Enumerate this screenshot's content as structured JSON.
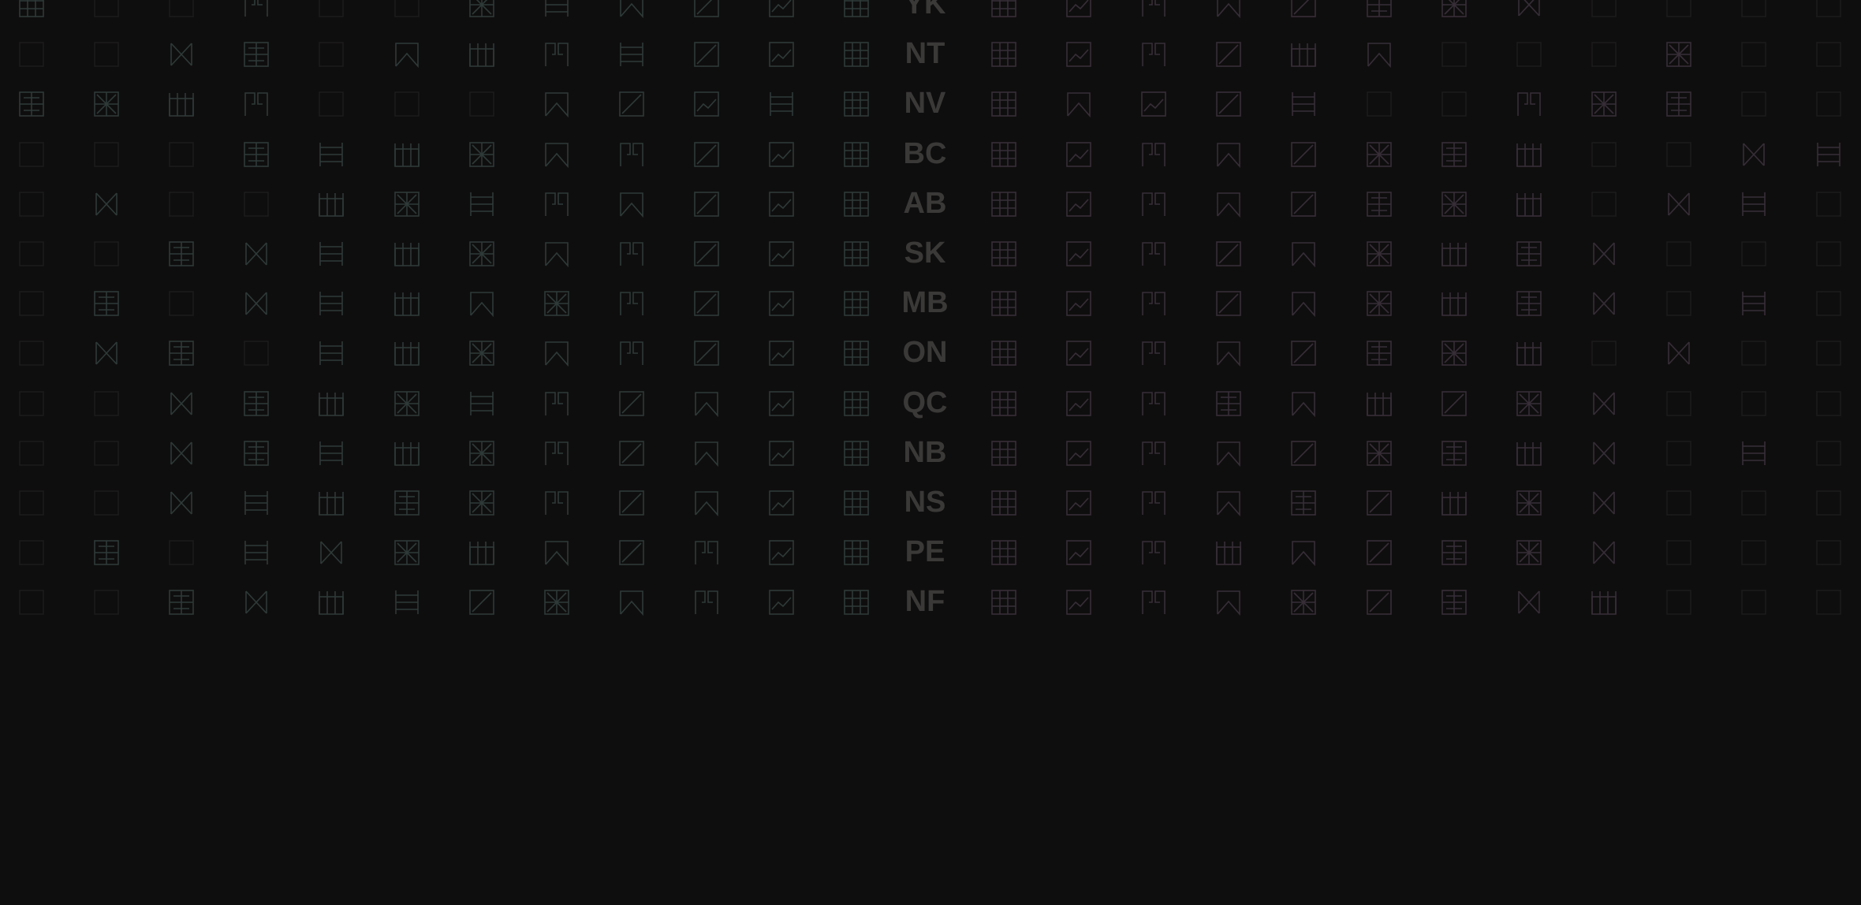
{
  "colors": {
    "background": "#0f0e0e",
    "left_tint": "#2e3a38",
    "right_tint": "#372e38",
    "empty_box": "#1c1c1c",
    "label": "#3a3938"
  },
  "labels": [
    "YK",
    "NT",
    "NV",
    "BC",
    "AB",
    "SK",
    "MB",
    "ON",
    "QC",
    "NB",
    "NS",
    "PE",
    "NF"
  ],
  "rows": [
    {
      "left": [
        "grid-icon",
        "empty",
        "empty",
        "flag-icon",
        "empty",
        "empty",
        "cross-box-icon",
        "rows-icon",
        "bookmark-icon",
        "diagonal-icon",
        "chart-icon",
        "grid-icon"
      ],
      "right": [
        "grid-icon",
        "chart-icon",
        "flag-icon",
        "bookmark-icon",
        "diagonal-icon",
        "window-icon",
        "cross-box-icon",
        "bowtie-icon",
        "empty",
        "empty",
        "empty",
        "empty"
      ]
    },
    {
      "left": [
        "empty",
        "empty",
        "bowtie-icon",
        "window-icon",
        "empty",
        "bookmark-icon",
        "columns-icon",
        "flag-icon",
        "rows-icon",
        "diagonal-icon",
        "chart-icon",
        "grid-icon"
      ],
      "right": [
        "grid-icon",
        "chart-icon",
        "flag-icon",
        "diagonal-icon",
        "columns-icon",
        "bookmark-icon",
        "empty",
        "empty",
        "empty",
        "cross-box-icon",
        "empty",
        "empty"
      ]
    },
    {
      "left": [
        "window-icon",
        "cross-box-icon",
        "columns-icon",
        "flag-icon",
        "empty",
        "empty",
        "empty",
        "bookmark-icon",
        "diagonal-icon",
        "chart-icon",
        "rows-icon",
        "grid-icon"
      ],
      "right": [
        "grid-icon",
        "bookmark-icon",
        "chart-icon",
        "diagonal-icon",
        "rows-icon",
        "empty",
        "empty",
        "flag-icon",
        "cross-box-icon",
        "window-icon",
        "empty",
        "empty"
      ]
    },
    {
      "left": [
        "empty",
        "empty",
        "empty",
        "window-icon",
        "rows-icon",
        "columns-icon",
        "cross-box-icon",
        "bookmark-icon",
        "flag-icon",
        "diagonal-icon",
        "chart-icon",
        "grid-icon"
      ],
      "right": [
        "grid-icon",
        "chart-icon",
        "flag-icon",
        "bookmark-icon",
        "diagonal-icon",
        "cross-box-icon",
        "window-icon",
        "columns-icon",
        "empty",
        "empty",
        "bowtie-icon",
        "rows-icon"
      ]
    },
    {
      "left": [
        "empty",
        "bowtie-icon",
        "empty",
        "empty",
        "columns-icon",
        "cross-box-icon",
        "rows-icon",
        "flag-icon",
        "bookmark-icon",
        "diagonal-icon",
        "chart-icon",
        "grid-icon"
      ],
      "right": [
        "grid-icon",
        "chart-icon",
        "flag-icon",
        "bookmark-icon",
        "diagonal-icon",
        "window-icon",
        "cross-box-icon",
        "columns-icon",
        "empty",
        "bowtie-icon",
        "rows-icon",
        "empty"
      ]
    },
    {
      "left": [
        "empty",
        "empty",
        "window-icon",
        "bowtie-icon",
        "rows-icon",
        "columns-icon",
        "cross-box-icon",
        "bookmark-icon",
        "flag-icon",
        "diagonal-icon",
        "chart-icon",
        "grid-icon"
      ],
      "right": [
        "grid-icon",
        "chart-icon",
        "flag-icon",
        "diagonal-icon",
        "bookmark-icon",
        "cross-box-icon",
        "columns-icon",
        "window-icon",
        "bowtie-icon",
        "empty",
        "empty",
        "empty"
      ]
    },
    {
      "left": [
        "empty",
        "window-icon",
        "empty",
        "bowtie-icon",
        "rows-icon",
        "columns-icon",
        "bookmark-icon",
        "cross-box-icon",
        "flag-icon",
        "diagonal-icon",
        "chart-icon",
        "grid-icon"
      ],
      "right": [
        "grid-icon",
        "chart-icon",
        "flag-icon",
        "diagonal-icon",
        "bookmark-icon",
        "cross-box-icon",
        "columns-icon",
        "window-icon",
        "bowtie-icon",
        "empty",
        "rows-icon",
        "empty"
      ]
    },
    {
      "left": [
        "empty",
        "bowtie-icon",
        "window-icon",
        "empty",
        "rows-icon",
        "columns-icon",
        "cross-box-icon",
        "bookmark-icon",
        "flag-icon",
        "diagonal-icon",
        "chart-icon",
        "grid-icon"
      ],
      "right": [
        "grid-icon",
        "chart-icon",
        "flag-icon",
        "bookmark-icon",
        "diagonal-icon",
        "window-icon",
        "cross-box-icon",
        "columns-icon",
        "empty",
        "bowtie-icon",
        "empty",
        "empty"
      ]
    },
    {
      "left": [
        "empty",
        "empty",
        "bowtie-icon",
        "window-icon",
        "columns-icon",
        "cross-box-icon",
        "rows-icon",
        "flag-icon",
        "diagonal-icon",
        "bookmark-icon",
        "chart-icon",
        "grid-icon"
      ],
      "right": [
        "grid-icon",
        "chart-icon",
        "flag-icon",
        "window-icon",
        "bookmark-icon",
        "columns-icon",
        "diagonal-icon",
        "cross-box-icon",
        "bowtie-icon",
        "empty",
        "empty",
        "empty"
      ]
    },
    {
      "left": [
        "empty",
        "empty",
        "bowtie-icon",
        "window-icon",
        "rows-icon",
        "columns-icon",
        "cross-box-icon",
        "flag-icon",
        "diagonal-icon",
        "bookmark-icon",
        "chart-icon",
        "grid-icon"
      ],
      "right": [
        "grid-icon",
        "chart-icon",
        "flag-icon",
        "bookmark-icon",
        "diagonal-icon",
        "cross-box-icon",
        "window-icon",
        "columns-icon",
        "bowtie-icon",
        "empty",
        "rows-icon",
        "empty"
      ]
    },
    {
      "left": [
        "empty",
        "empty",
        "bowtie-icon",
        "rows-icon",
        "columns-icon",
        "window-icon",
        "cross-box-icon",
        "flag-icon",
        "diagonal-icon",
        "bookmark-icon",
        "chart-icon",
        "grid-icon"
      ],
      "right": [
        "grid-icon",
        "chart-icon",
        "flag-icon",
        "bookmark-icon",
        "window-icon",
        "diagonal-icon",
        "columns-icon",
        "cross-box-icon",
        "bowtie-icon",
        "empty",
        "empty",
        "empty"
      ]
    },
    {
      "left": [
        "empty",
        "window-icon",
        "empty",
        "rows-icon",
        "bowtie-icon",
        "cross-box-icon",
        "columns-icon",
        "bookmark-icon",
        "diagonal-icon",
        "flag-icon",
        "chart-icon",
        "grid-icon"
      ],
      "right": [
        "grid-icon",
        "chart-icon",
        "flag-icon",
        "columns-icon",
        "bookmark-icon",
        "diagonal-icon",
        "window-icon",
        "cross-box-icon",
        "bowtie-icon",
        "empty",
        "empty",
        "empty"
      ]
    },
    {
      "left": [
        "empty",
        "empty",
        "window-icon",
        "bowtie-icon",
        "columns-icon",
        "rows-icon",
        "diagonal-icon",
        "cross-box-icon",
        "bookmark-icon",
        "flag-icon",
        "chart-icon",
        "grid-icon"
      ],
      "right": [
        "grid-icon",
        "chart-icon",
        "flag-icon",
        "bookmark-icon",
        "cross-box-icon",
        "diagonal-icon",
        "window-icon",
        "bowtie-icon",
        "columns-icon",
        "empty",
        "empty",
        "empty"
      ]
    }
  ]
}
